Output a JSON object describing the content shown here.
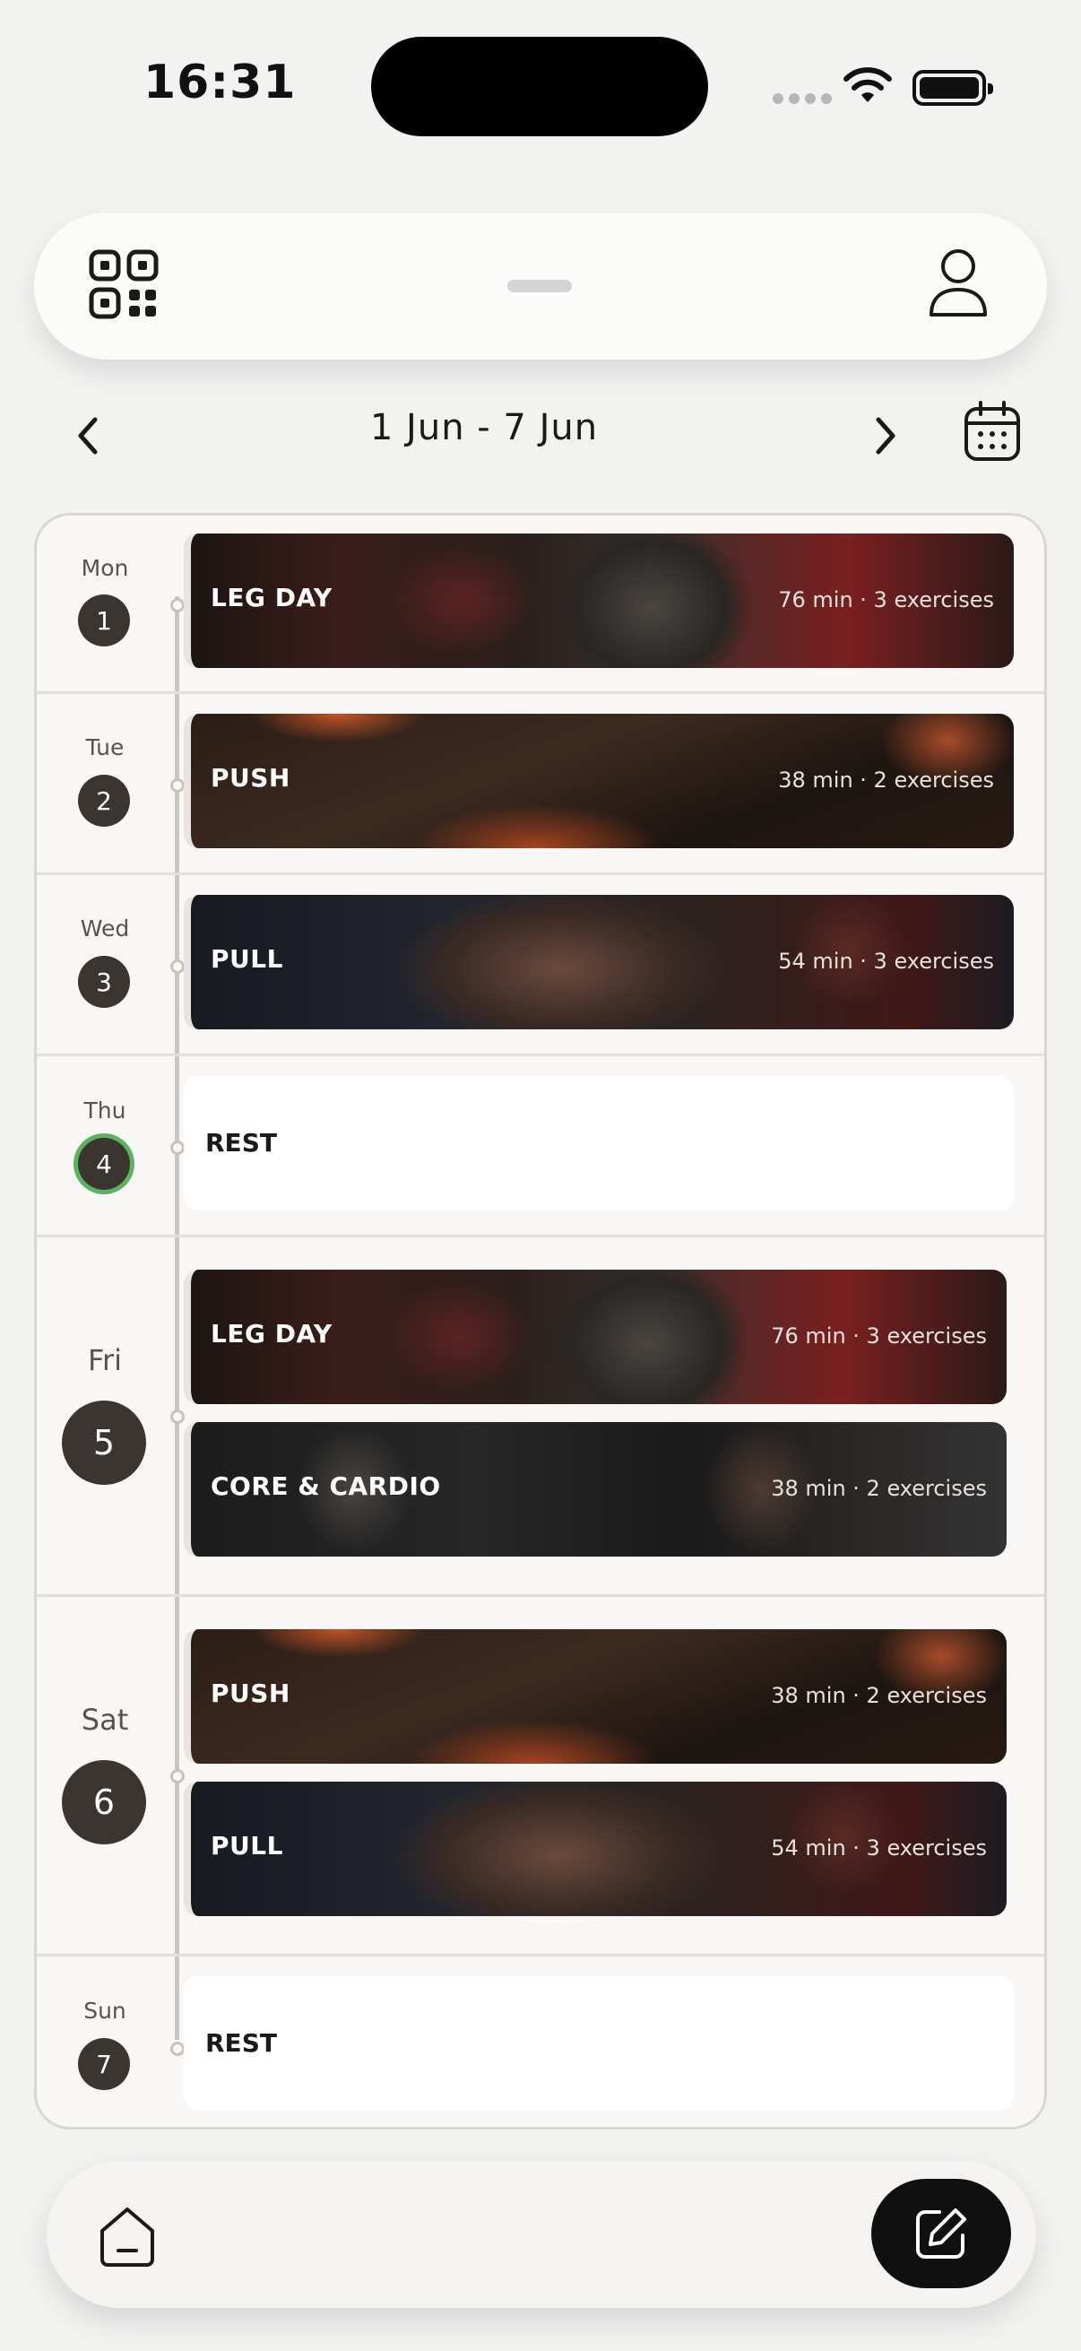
{
  "status_bar": {
    "time": "16:31"
  },
  "week_nav": {
    "range": "1 Jun - 7 Jun"
  },
  "days": [
    {
      "dayname": "Mon",
      "daynum": "1",
      "workouts": [
        {
          "name": "LEG DAY",
          "meta": "76 min · 3 exercises",
          "theme": "leg"
        }
      ]
    },
    {
      "dayname": "Tue",
      "daynum": "2",
      "workouts": [
        {
          "name": "PUSH",
          "meta": "38 min · 2 exercises",
          "theme": "push"
        }
      ]
    },
    {
      "dayname": "Wed",
      "daynum": "3",
      "workouts": [
        {
          "name": "PULL",
          "meta": "54 min · 3 exercises",
          "theme": "pull"
        }
      ]
    },
    {
      "dayname": "Thu",
      "daynum": "4",
      "today": true,
      "rest_label": "REST"
    },
    {
      "dayname": "Fri",
      "daynum": "5",
      "workouts": [
        {
          "name": "LEG DAY",
          "meta": "76 min · 3 exercises",
          "theme": "leg"
        },
        {
          "name": "CORE & CARDIO",
          "meta": "38 min · 2 exercises",
          "theme": "core"
        }
      ]
    },
    {
      "dayname": "Sat",
      "daynum": "6",
      "workouts": [
        {
          "name": "PUSH",
          "meta": "38 min · 2 exercises",
          "theme": "push"
        },
        {
          "name": "PULL",
          "meta": "54 min · 3 exercises",
          "theme": "pull"
        }
      ]
    },
    {
      "dayname": "Sun",
      "daynum": "7",
      "rest_label": "REST"
    }
  ],
  "colors": {
    "accent_today": "#5ab45e",
    "day_badge": "#3a3530",
    "fab": "#101010"
  }
}
